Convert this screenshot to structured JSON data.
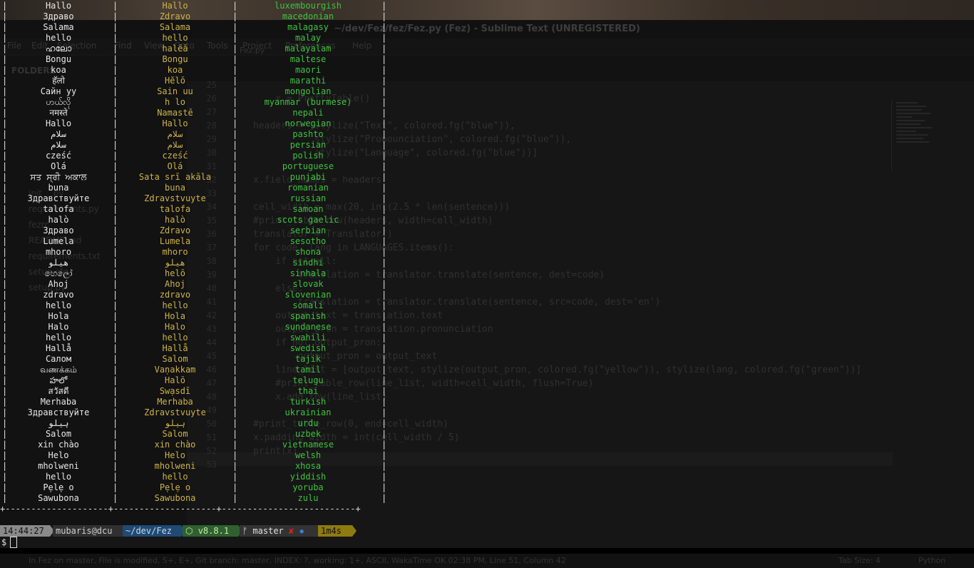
{
  "editor": {
    "title": "~/dev/Fez/fez/Fez.py (Fez) - Sublime Text (UNREGISTERED)",
    "menu": [
      "File",
      "Edit",
      "Selection",
      "Find",
      "View",
      "Goto",
      "Tools",
      "Project",
      "Preferences",
      "Help"
    ],
    "sidebar_title": "FOLDERS",
    "sidebar_items": [
      "init__.py",
      "requirements.py",
      "fezrc",
      "README.md",
      "requirements.txt",
      "setup.cfg",
      "setup.py"
    ],
    "tab": "Fez.py",
    "line_numbers": [
      "25",
      "26",
      "27",
      "28",
      "29",
      "30",
      "31",
      "32",
      "33",
      "34",
      "35",
      "36",
      "37",
      "38",
      "39",
      "40",
      "41",
      "42",
      "43",
      "44",
      "45",
      "46",
      "47",
      "48",
      "49",
      "50",
      "51",
      "52",
      "53"
    ],
    "code": [
      "",
      "    x = PrettyTable()",
      "",
      "headers = [stylize(\"Text\", colored.fg(\"blue\")),",
      "           stylize(\"Pronounciation\", colored.fg(\"blue\")),",
      "           stylize(\"Language\", colored.fg(\"blue\"))]",
      "",
      "x.field_names = headers",
      "",
      "cell_width = max(20, int(2.5 * len(sentence)))",
      "#print_table_row(headers, width=cell_width)",
      "translator = Translator()",
      "for code, lang in LANGUAGES.items():",
      "    if not all:",
      "        translation = translator.translate(sentence, dest=code)",
      "    else:",
      "        translation = translator.translate(sentence, src=code, dest='en')",
      "    output_text = translation.text",
      "    output_pron = translation.pronunciation",
      "    if not output_pron:",
      "        output_pron = output_text",
      "    line_list = [output_text, stylize(output_pron, colored.fg(\"yellow\")), stylize(lang, colored.fg(\"green\"))]",
      "    #print_table_row(line_list, width=cell_width, flush=True)",
      "    x.add_row(line_list)",
      "",
      "#print_table_row(0, end=cell_width)",
      "x.padding_width = int(cell_width / 5)",
      "print(x)",
      ""
    ],
    "status_left": "In Fez on master, File is modified, S+, E+, Git branch: master, INDEX: ?, working: 1+, ASCII, WakaTime OK 02:38 PM, Line 51, Column 42",
    "status_tab": "Tab Size: 4",
    "status_syntax": "Python"
  },
  "rows": [
    {
      "text": "Hallo",
      "pron": "Hallo",
      "lang": "luxembourgish"
    },
    {
      "text": "Здраво",
      "pron": "Zdravo",
      "lang": "macedonian"
    },
    {
      "text": "Salama",
      "pron": "Salama",
      "lang": "malagasy"
    },
    {
      "text": "hello",
      "pron": "hello",
      "lang": "malay"
    },
    {
      "text": "ഹലോ",
      "pron": "halēā",
      "lang": "malayalam"
    },
    {
      "text": "Bongu",
      "pron": "Bongu",
      "lang": "maltese"
    },
    {
      "text": "koa",
      "pron": "koa",
      "lang": "maori"
    },
    {
      "text": "हॅलो",
      "pron": "Hĕlō",
      "lang": "marathi"
    },
    {
      "text": "Сайн уу",
      "pron": "Sain uu",
      "lang": "mongolian"
    },
    {
      "text": "ဟယ်လို",
      "pron": "h lo",
      "lang": "myanmar (burmese)"
    },
    {
      "text": "नमस्ते",
      "pron": "Namastē",
      "lang": "nepali"
    },
    {
      "text": "Hallo",
      "pron": "Hallo",
      "lang": "norwegian"
    },
    {
      "text": "سلام",
      "pron": "سلام",
      "lang": "pashto"
    },
    {
      "text": "سلام",
      "pron": "سلام",
      "lang": "persian"
    },
    {
      "text": "cześć",
      "pron": "cześć",
      "lang": "polish"
    },
    {
      "text": "Olá",
      "pron": "Olá",
      "lang": "portuguese"
    },
    {
      "text": "ਸਤ ਸ੍ਰੀ ਅਕਾਲ",
      "pron": "Sata srī akāla",
      "lang": "punjabi"
    },
    {
      "text": "buna",
      "pron": "buna",
      "lang": "romanian"
    },
    {
      "text": "Здравствуйте",
      "pron": "Zdravstvuyte",
      "lang": "russian"
    },
    {
      "text": "talofa",
      "pron": "talofa",
      "lang": "samoan"
    },
    {
      "text": "halò",
      "pron": "halò",
      "lang": "scots gaelic"
    },
    {
      "text": "Здраво",
      "pron": "Zdravo",
      "lang": "serbian"
    },
    {
      "text": "Lumela",
      "pron": "Lumela",
      "lang": "sesotho"
    },
    {
      "text": "mhoro",
      "pron": "mhoro",
      "lang": "shona"
    },
    {
      "text": "هيلو",
      "pron": "هيلو",
      "lang": "sindhi"
    },
    {
      "text": "හෙලෝ",
      "pron": "helō",
      "lang": "sinhala"
    },
    {
      "text": "Ahoj",
      "pron": "Ahoj",
      "lang": "slovak"
    },
    {
      "text": "zdravo",
      "pron": "zdravo",
      "lang": "slovenian"
    },
    {
      "text": "hello",
      "pron": "hello",
      "lang": "somali"
    },
    {
      "text": "Hola",
      "pron": "Hola",
      "lang": "spanish"
    },
    {
      "text": "Halo",
      "pron": "Halo",
      "lang": "sundanese"
    },
    {
      "text": "hello",
      "pron": "hello",
      "lang": "swahili"
    },
    {
      "text": "Hallå",
      "pron": "Hallå",
      "lang": "swedish"
    },
    {
      "text": "Салом",
      "pron": "Salom",
      "lang": "tajik"
    },
    {
      "text": "வணக்கம்",
      "pron": "Vaṇakkam",
      "lang": "tamil"
    },
    {
      "text": "హలో",
      "pron": "Halō",
      "lang": "telugu"
    },
    {
      "text": "สวัสดี",
      "pron": "Swạsdī",
      "lang": "thai"
    },
    {
      "text": "Merhaba",
      "pron": "Merhaba",
      "lang": "turkish"
    },
    {
      "text": "Здравствуйте",
      "pron": "Zdravstvuyte",
      "lang": "ukrainian"
    },
    {
      "text": "ہیلو",
      "pron": "ہیلو",
      "lang": "urdu"
    },
    {
      "text": "Salom",
      "pron": "Salom",
      "lang": "uzbek"
    },
    {
      "text": "xin chào",
      "pron": "xin chào",
      "lang": "vietnamese"
    },
    {
      "text": "Helo",
      "pron": "Helo",
      "lang": "welsh"
    },
    {
      "text": "mholweni",
      "pron": "mholweni",
      "lang": "xhosa"
    },
    {
      "text": "hello",
      "pron": "hello",
      "lang": "yiddish"
    },
    {
      "text": "Pẹlẹ o",
      "pron": "Pẹlẹ o",
      "lang": "yoruba"
    },
    {
      "text": "Sawubona",
      "pron": "Sawubona",
      "lang": "zulu"
    }
  ],
  "table_border": "+--------------------+--------------------+--------------------------+",
  "prompt": {
    "time": "14:44:27",
    "user_host": "mubaris@dcu",
    "dir": "~/dev/Fez",
    "node": "⬡ v8.8.1",
    "git_branch": "ᚠ master",
    "git_dirty": "✘",
    "git_stash": "✹",
    "duration": "1m4s",
    "symbol": "$"
  },
  "colors": {
    "text": "#e8e8e8",
    "pronunciation": "#cdb24a",
    "language": "#3fc23f",
    "git_dirty": "#e02020",
    "git_stash": "#4080e0"
  }
}
